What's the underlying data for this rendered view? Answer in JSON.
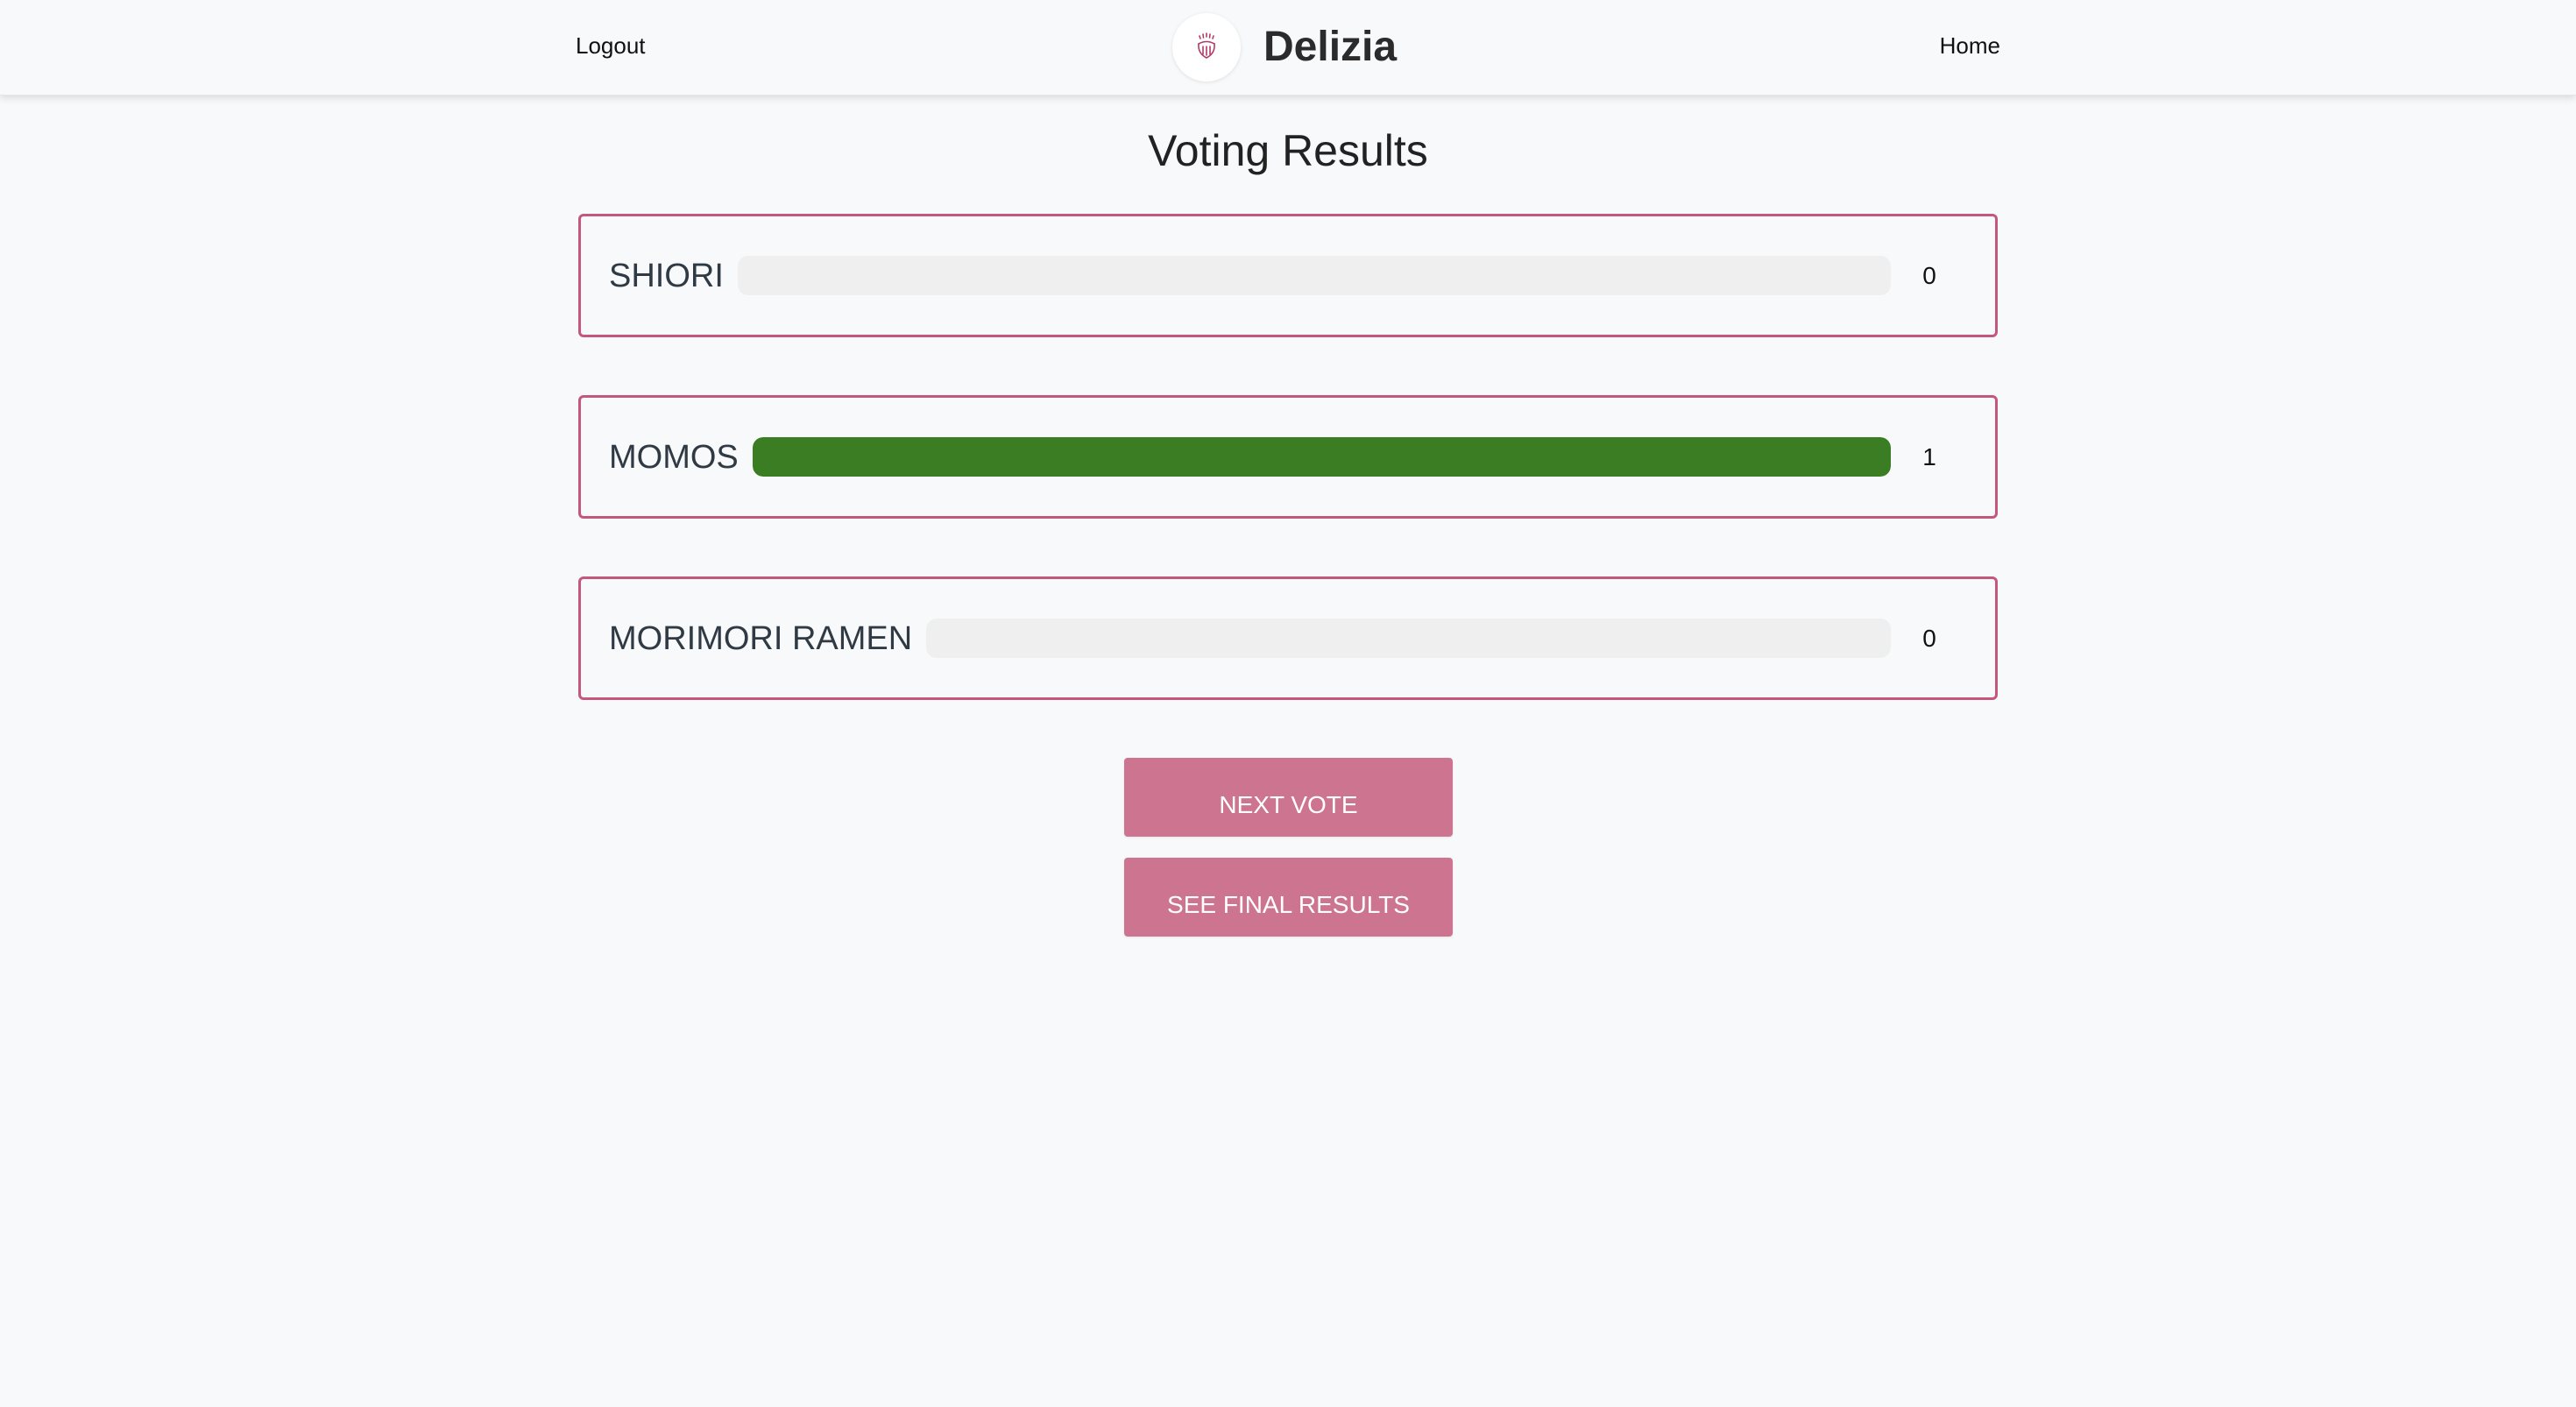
{
  "nav": {
    "logout_label": "Logout",
    "home_label": "Home",
    "brand_name": "Delizia",
    "logo_icon": "food-logo-icon"
  },
  "page": {
    "title": "Voting Results"
  },
  "colors": {
    "accent": "#c5587a",
    "button": "#cd7590",
    "bar_fill": "#3a7d22",
    "bar_track": "#efefef"
  },
  "results": [
    {
      "name": "SHIORI",
      "votes": "0",
      "fraction": 0
    },
    {
      "name": "MOMOS",
      "votes": "1",
      "fraction": 1
    },
    {
      "name": "MORIMORI RAMEN",
      "votes": "0",
      "fraction": 0
    }
  ],
  "actions": {
    "next_vote_label": "NEXT VOTE",
    "final_results_label": "SEE FINAL RESULTS"
  }
}
